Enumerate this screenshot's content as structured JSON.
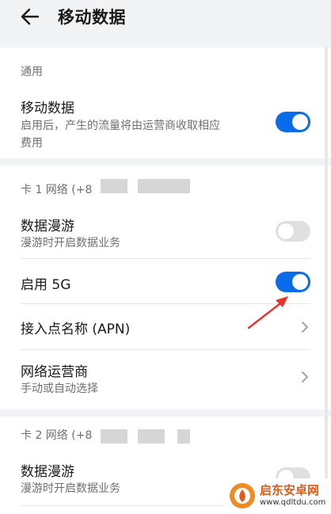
{
  "header": {
    "title": "移动数据"
  },
  "general": {
    "section_label": "通用",
    "mobile_data": {
      "title": "移动数据",
      "description_line1": "启用后，产生的流量将由运营商收取相应",
      "description_line2": "费用",
      "enabled": true
    }
  },
  "sim1": {
    "section_label": "卡 1 网络 (+8",
    "roaming": {
      "title": "数据漫游",
      "description": "漫游时开启数据业务",
      "enabled": false
    },
    "enable_5g": {
      "title": "启用 5G",
      "enabled": true
    },
    "apn": {
      "title": "接入点名称 (APN)"
    },
    "carrier": {
      "title": "网络运营商",
      "description": "手动或自动选择"
    }
  },
  "sim2": {
    "section_label": "卡 2 网络 (+8",
    "roaming": {
      "title": "数据漫游",
      "description": "漫游时开启数据业务",
      "enabled": false
    }
  },
  "watermark": {
    "name": "启东安卓网",
    "url": "www.qdltdu.com"
  },
  "colors": {
    "accent": "#0a6ce9",
    "toggle_off": "#e0e0e0",
    "background": "#f1f3f5",
    "annotation_arrow": "#e8322a"
  },
  "icons": {
    "back": "back-arrow-icon",
    "chevron": "chevron-right-icon",
    "annotation": "red-arrow-annotation",
    "watermark_logo": "watermark-logo-icon"
  }
}
